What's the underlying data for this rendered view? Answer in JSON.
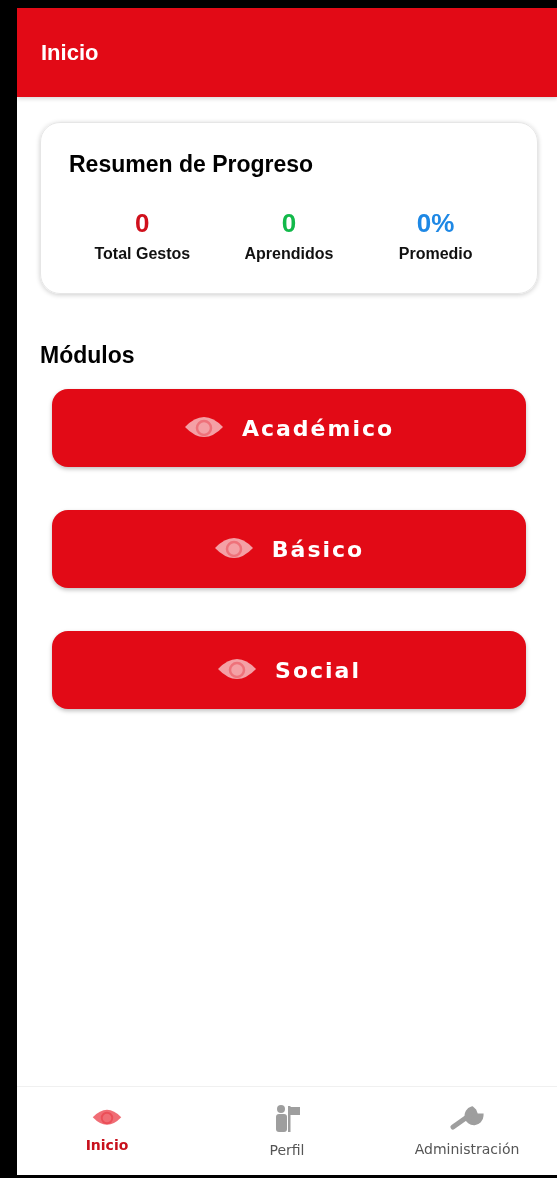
{
  "header": {
    "title": "Inicio"
  },
  "summary": {
    "title": "Resumen de Progreso",
    "stats": [
      {
        "value": "0",
        "label": "Total Gestos",
        "color": "#d0101c"
      },
      {
        "value": "0",
        "label": "Aprendidos",
        "color": "#12b94a"
      },
      {
        "value": "0%",
        "label": "Promedio",
        "color": "#1e88e5"
      }
    ]
  },
  "modules": {
    "title": "Módulos",
    "items": [
      "Académico",
      "Básico",
      "Social"
    ]
  },
  "tab_bar": [
    {
      "label": "Inicio",
      "kind": "eye",
      "selected": true
    },
    {
      "label": "Perfil",
      "kind": "person",
      "selected": false
    },
    {
      "label": "Administración",
      "kind": "wrench",
      "selected": false
    }
  ]
}
